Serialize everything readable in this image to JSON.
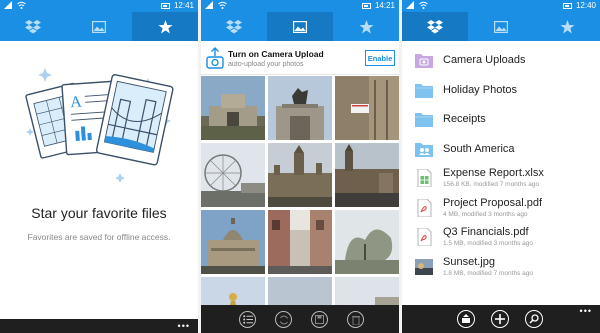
{
  "statusbar": {
    "time_1": "12:41",
    "time_2": "14:21",
    "time_3": "12:40"
  },
  "tabs": [
    {
      "name": "dropbox-icon",
      "label": "Files"
    },
    {
      "name": "photos-icon",
      "label": "Photos"
    },
    {
      "name": "star-icon",
      "label": "Favorites"
    }
  ],
  "colors": {
    "accent": "#1a8fe3",
    "accent_active": "#1579c4",
    "appbar": "#1f1f1f",
    "folder": "#7ec3ef"
  },
  "favorites": {
    "title": "Star your favorite files",
    "subtitle": "Favorites are saved for offline access."
  },
  "camera_upload": {
    "title": "Turn on Camera Upload",
    "subtitle": "auto-upload your photos",
    "button": "Enable"
  },
  "photos": [
    {
      "name": "photo-wellington-arch"
    },
    {
      "name": "photo-quadriga-arch"
    },
    {
      "name": "photo-westminster-sign"
    },
    {
      "name": "photo-london-eye"
    },
    {
      "name": "photo-parliament"
    },
    {
      "name": "photo-parliament-street"
    },
    {
      "name": "photo-dome-building"
    },
    {
      "name": "photo-street-view"
    },
    {
      "name": "photo-park-tree"
    },
    {
      "name": "photo-golden-statue"
    },
    {
      "name": "photo-sky-building"
    },
    {
      "name": "photo-square-sculpture"
    }
  ],
  "photos_appbar": [
    "select-icon",
    "sync-icon",
    "save-icon",
    "delete-icon"
  ],
  "files": [
    {
      "name": "Camera Uploads",
      "meta": "",
      "icon": "camera-folder-icon"
    },
    {
      "name": "Holiday Photos",
      "meta": "",
      "icon": "folder-icon"
    },
    {
      "name": "Receipts",
      "meta": "",
      "icon": "folder-icon"
    },
    {
      "name": "South America",
      "meta": "",
      "icon": "shared-folder-icon"
    },
    {
      "name": "Expense Report.xlsx",
      "meta": "156.8 KB, modified 7 months ago",
      "icon": "spreadsheet-icon"
    },
    {
      "name": "Project Proposal.pdf",
      "meta": "4 MB, modified 3 months ago",
      "icon": "pdf-icon"
    },
    {
      "name": "Q3 Financials.pdf",
      "meta": "1.5 MB, modified 3 months ago",
      "icon": "pdf-icon"
    },
    {
      "name": "Sunset.jpg",
      "meta": "1.8 MB, modified 7 months ago",
      "icon": "image-thumb-icon"
    }
  ],
  "files_appbar": [
    "upload-icon",
    "add-icon",
    "search-icon"
  ],
  "appbar": {
    "more": "•••"
  }
}
